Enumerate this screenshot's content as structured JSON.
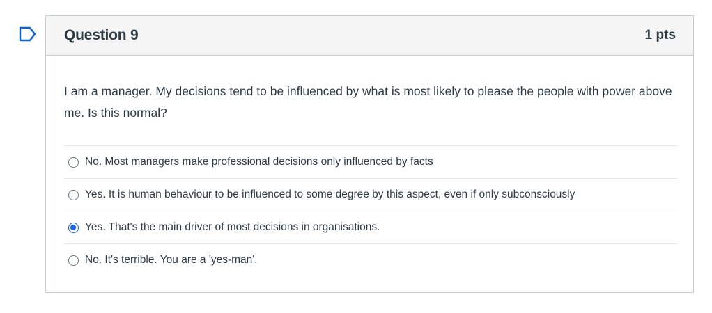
{
  "question": {
    "title": "Question 9",
    "points": "1 pts",
    "text": "I am a manager. My decisions tend to be influenced by what is most likely to please the people with power above me. Is this normal?",
    "answers": [
      {
        "label": "No. Most managers make professional decisions only influenced by facts",
        "selected": false
      },
      {
        "label": "Yes. It is human behaviour to be influenced to some degree by this aspect, even if only subconsciously",
        "selected": false
      },
      {
        "label": "Yes. That's the main driver of most decisions in organisations.",
        "selected": true
      },
      {
        "label": "No. It's terrible. You are a 'yes-man'.",
        "selected": false
      }
    ]
  },
  "icons": {
    "flag": "bookmark-flag-icon"
  },
  "colors": {
    "accent": "#1a66e0",
    "flag": "#0b62d4",
    "header_bg": "#f5f5f5",
    "border": "#c7cdd1",
    "text": "#2d3b45"
  }
}
